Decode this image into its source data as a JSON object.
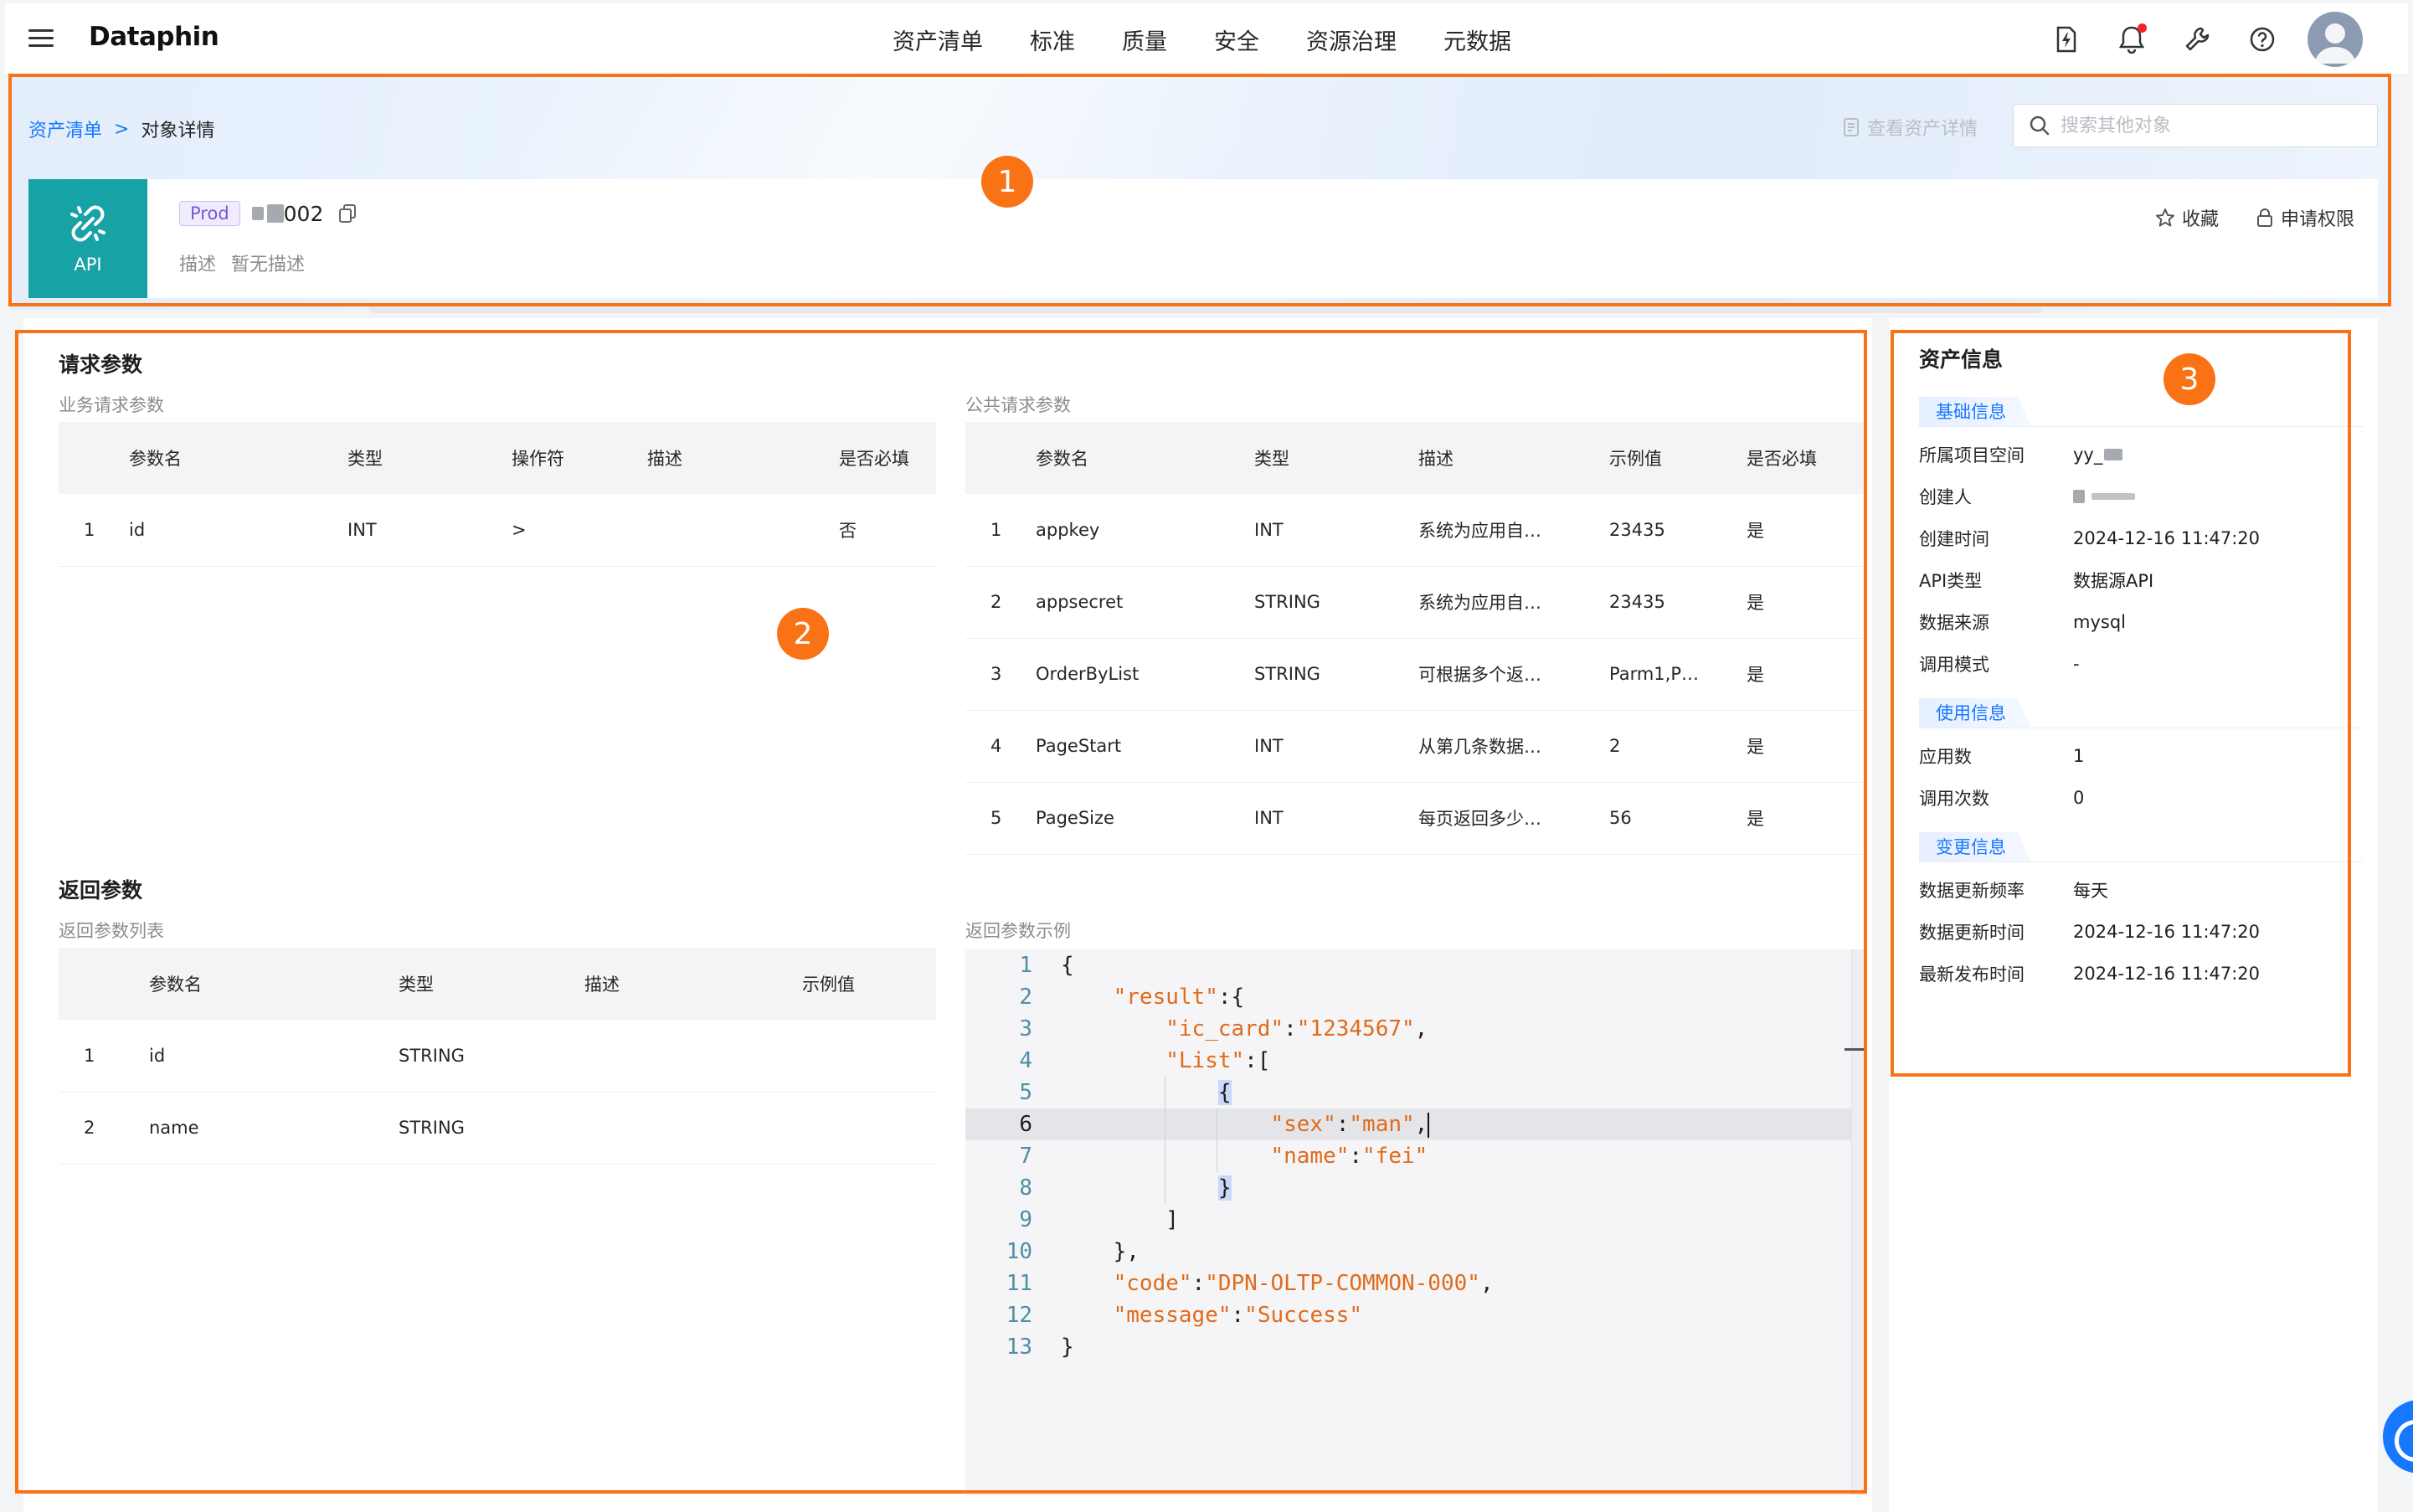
{
  "topbar": {
    "logo": "Dataphin",
    "nav": [
      "资产清单",
      "标准",
      "质量",
      "安全",
      "资源治理",
      "元数据"
    ],
    "icons": [
      "lightning-tag-icon",
      "bell-icon",
      "wrench-icon",
      "help-icon"
    ]
  },
  "header": {
    "breadcrumb_root": "资产清单",
    "breadcrumb_sep": ">",
    "breadcrumb_current": "对象详情",
    "view_asset_label": "查看资产详情",
    "search_placeholder": "搜索其他对象",
    "api_label": "API",
    "env_tag": "Prod",
    "object_name_suffix": "002",
    "desc_label": "描述",
    "desc_value": "暂无描述",
    "favorite_label": "收藏",
    "apply_label": "申请权限"
  },
  "request": {
    "title": "请求参数",
    "biz_subtitle": "业务请求参数",
    "biz_headers": [
      "",
      "参数名",
      "类型",
      "操作符",
      "描述",
      "是否必填"
    ],
    "biz_rows": [
      [
        "1",
        "id",
        "INT",
        ">",
        "",
        "否"
      ]
    ],
    "public_subtitle": "公共请求参数",
    "public_headers": [
      "",
      "参数名",
      "类型",
      "描述",
      "示例值",
      "是否必填"
    ],
    "public_rows": [
      [
        "1",
        "appkey",
        "INT",
        "系统为应用自…",
        "23435",
        "是"
      ],
      [
        "2",
        "appsecret",
        "STRING",
        "系统为应用自…",
        "23435",
        "是"
      ],
      [
        "3",
        "OrderByList",
        "STRING",
        "可根据多个返…",
        "Parm1,P…",
        "是"
      ],
      [
        "4",
        "PageStart",
        "INT",
        "从第几条数据…",
        "2",
        "是"
      ],
      [
        "5",
        "PageSize",
        "INT",
        "每页返回多少…",
        "56",
        "是"
      ]
    ]
  },
  "response": {
    "title": "返回参数",
    "list_subtitle": "返回参数列表",
    "headers": [
      "",
      "参数名",
      "类型",
      "描述",
      "示例值"
    ],
    "rows": [
      [
        "1",
        "id",
        "STRING",
        "",
        ""
      ],
      [
        "2",
        "name",
        "STRING",
        "",
        ""
      ]
    ],
    "example_subtitle": "返回参数示例",
    "code_lines": [
      "{",
      "    \"result\":{",
      "        \"ic_card\":\"1234567\",",
      "        \"List\":[",
      "            {",
      "                \"sex\":\"man\",",
      "                \"name\":\"fei\"",
      "            }",
      "        ]",
      "    },",
      "    \"code\":\"DPN-OLTP-COMMON-000\",",
      "    \"message\":\"Success\"",
      "}"
    ],
    "active_line": 6
  },
  "asset_info": {
    "title": "资产信息",
    "sections": [
      {
        "label": "基础信息",
        "items": [
          {
            "k": "所属项目空间",
            "v": "yy_"
          },
          {
            "k": "创建人",
            "v": ""
          },
          {
            "k": "创建时间",
            "v": "2024-12-16 11:47:20"
          },
          {
            "k": "API类型",
            "v": "数据源API"
          },
          {
            "k": "数据来源",
            "v": "mysql"
          },
          {
            "k": "调用模式",
            "v": "-"
          }
        ]
      },
      {
        "label": "使用信息",
        "items": [
          {
            "k": "应用数",
            "v": "1"
          },
          {
            "k": "调用次数",
            "v": "0"
          }
        ]
      },
      {
        "label": "变更信息",
        "items": [
          {
            "k": "数据更新频率",
            "v": "每天"
          },
          {
            "k": "数据更新时间",
            "v": "2024-12-16 11:47:20"
          },
          {
            "k": "最新发布时间",
            "v": "2024-12-16 11:47:20"
          }
        ]
      }
    ]
  },
  "annotations": [
    "1",
    "2",
    "3"
  ],
  "colors": {
    "accent": "#1677ff",
    "api_tile": "#17a2a6",
    "annotation": "#f97316",
    "env_tag": "#7a55d8"
  }
}
